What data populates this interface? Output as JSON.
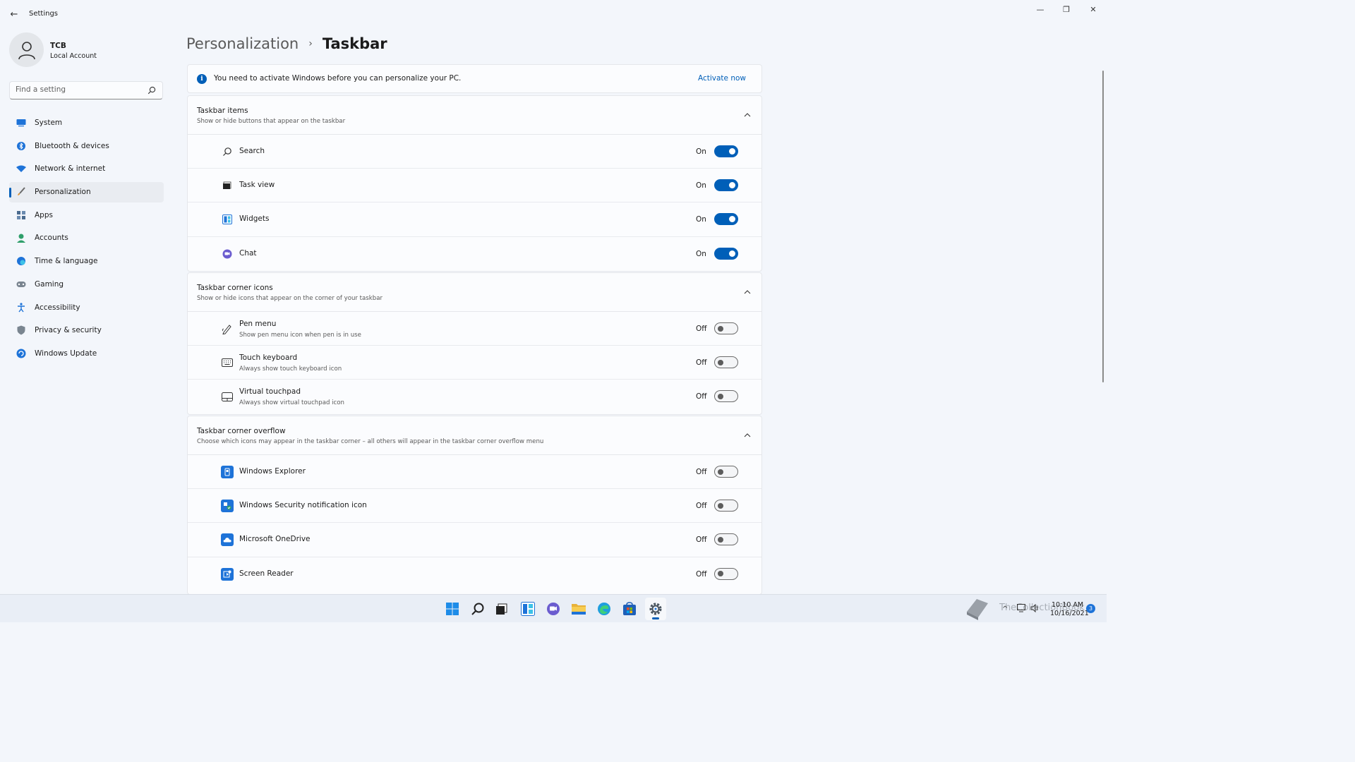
{
  "window": {
    "title": "Settings",
    "back_glyph": "←",
    "minimize_glyph": "—",
    "maximize_glyph": "❐",
    "close_glyph": "✕"
  },
  "user": {
    "name": "TCB",
    "account_type": "Local Account"
  },
  "search": {
    "placeholder": "Find a setting"
  },
  "sidebar": {
    "items": [
      {
        "label": "System",
        "icon": "monitor-icon"
      },
      {
        "label": "Bluetooth & devices",
        "icon": "bluetooth-icon"
      },
      {
        "label": "Network & internet",
        "icon": "wifi-icon"
      },
      {
        "label": "Personalization",
        "icon": "brush-icon",
        "active": true
      },
      {
        "label": "Apps",
        "icon": "apps-icon"
      },
      {
        "label": "Accounts",
        "icon": "person-icon"
      },
      {
        "label": "Time & language",
        "icon": "globe-clock-icon"
      },
      {
        "label": "Gaming",
        "icon": "gamepad-icon"
      },
      {
        "label": "Accessibility",
        "icon": "accessibility-icon"
      },
      {
        "label": "Privacy & security",
        "icon": "shield-icon"
      },
      {
        "label": "Windows Update",
        "icon": "update-icon"
      }
    ]
  },
  "breadcrumb": {
    "parent": "Personalization",
    "separator": "›",
    "current": "Taskbar"
  },
  "banner": {
    "info_glyph": "i",
    "text": "You need to activate Windows before you can personalize your PC.",
    "action": "Activate now"
  },
  "groups": {
    "taskbar_items": {
      "title": "Taskbar items",
      "desc": "Show or hide buttons that appear on the taskbar",
      "rows": [
        {
          "label": "Search",
          "state": "On",
          "on": true
        },
        {
          "label": "Task view",
          "state": "On",
          "on": true
        },
        {
          "label": "Widgets",
          "state": "On",
          "on": true
        },
        {
          "label": "Chat",
          "state": "On",
          "on": true
        }
      ]
    },
    "corner_icons": {
      "title": "Taskbar corner icons",
      "desc": "Show or hide icons that appear on the corner of your taskbar",
      "rows": [
        {
          "label": "Pen menu",
          "sub": "Show pen menu icon when pen is in use",
          "state": "Off",
          "on": false
        },
        {
          "label": "Touch keyboard",
          "sub": "Always show touch keyboard icon",
          "state": "Off",
          "on": false
        },
        {
          "label": "Virtual touchpad",
          "sub": "Always show virtual touchpad icon",
          "state": "Off",
          "on": false
        }
      ]
    },
    "corner_overflow": {
      "title": "Taskbar corner overflow",
      "desc": "Choose which icons may appear in the taskbar corner – all others will appear in the taskbar corner overflow menu",
      "rows": [
        {
          "label": "Windows Explorer",
          "state": "Off",
          "on": false
        },
        {
          "label": "Windows Security notification icon",
          "state": "Off",
          "on": false
        },
        {
          "label": "Microsoft OneDrive",
          "state": "Off",
          "on": false
        },
        {
          "label": "Screen Reader",
          "state": "Off",
          "on": false
        }
      ]
    }
  },
  "taskbar": {
    "clock_time": "10:10 AM",
    "clock_date": "10/16/2021",
    "notification_count": "3",
    "tray_chevron": "^",
    "watermark": "TheCollectionBook"
  },
  "colors": {
    "accent": "#005fb8",
    "background": "#f3f6fb",
    "card": "#fbfcfe"
  }
}
